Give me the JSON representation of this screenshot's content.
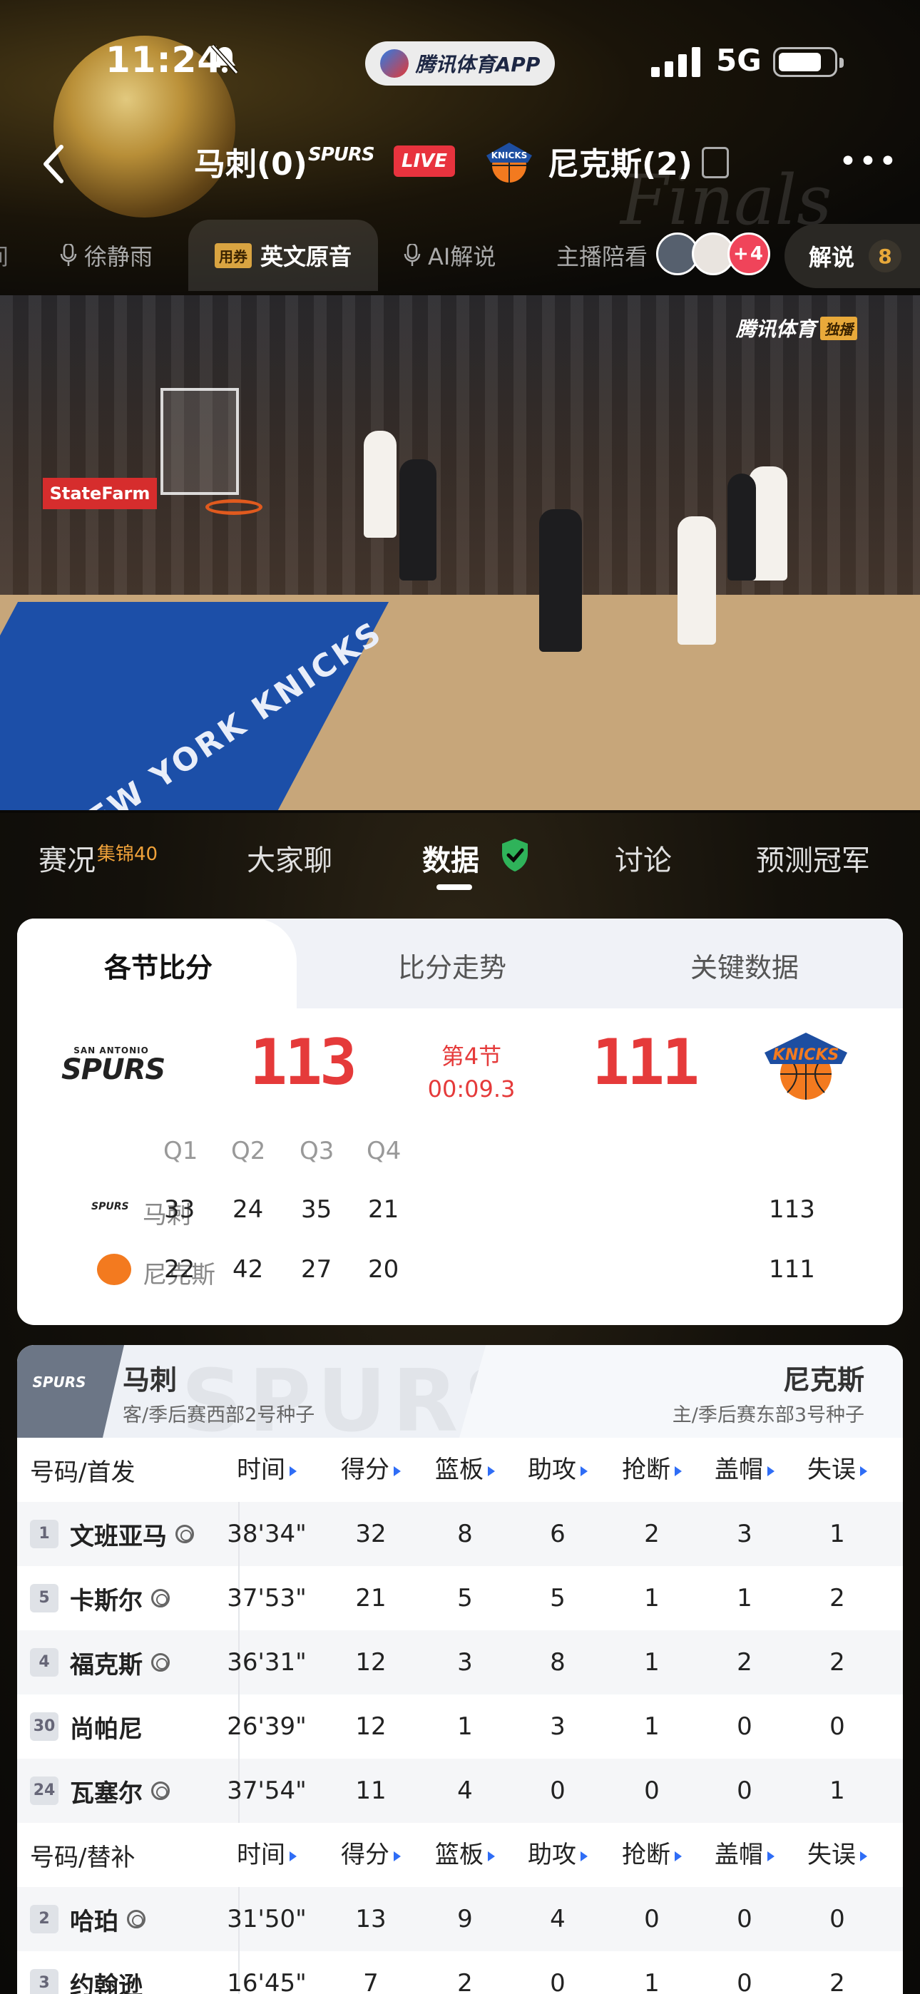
{
  "status_bar": {
    "time": "11:24",
    "app_pill": "腾讯体育APP",
    "network": "5G",
    "battery_level": 0.8
  },
  "header": {
    "team_a": "马刺(0)",
    "team_a_logo_text": "SPURS",
    "live": "LIVE",
    "team_b": "尼克斯(2)"
  },
  "commentary": {
    "tabs": [
      "徐静雨",
      "英文原音",
      "AI解说",
      "主播陪看"
    ],
    "coupon": "用券",
    "active": "英文原音",
    "more_avatars": "+4",
    "jieshuo_label": "解说",
    "jieshuo_count": "8"
  },
  "video": {
    "watermark": "腾讯体育",
    "exclusive": "独播",
    "sponsor": "StateFarm",
    "court_text": "NEW YORK KNICKS"
  },
  "main_tabs": [
    {
      "label": "赛况",
      "badge": "集锦40"
    },
    {
      "label": "大家聊",
      "badge": ""
    },
    {
      "label": "数据",
      "badge": ""
    },
    {
      "label": "讨论",
      "badge": ""
    },
    {
      "label": "预测冠军",
      "badge": ""
    }
  ],
  "score_card": {
    "tabs": [
      "各节比分",
      "比分走势",
      "关键数据"
    ],
    "spurs_logo_top": "SAN ANTONIO",
    "spurs_logo": "SPURS",
    "knicks_logo": "KNICKS",
    "home_score": "113",
    "away_score": "111",
    "period": "第4节",
    "clock": "00:09.3",
    "quarters": [
      "Q1",
      "Q2",
      "Q3",
      "Q4"
    ],
    "rows": [
      {
        "team": "马刺",
        "q": [
          "33",
          "24",
          "35",
          "21"
        ],
        "total": "113"
      },
      {
        "team": "尼克斯",
        "q": [
          "22",
          "42",
          "27",
          "20"
        ],
        "total": "111"
      }
    ]
  },
  "stats": {
    "left_team": "马刺",
    "left_sub": "客/季后赛西部2号种子",
    "right_team": "尼克斯",
    "right_sub": "主/季后赛东部3号种子",
    "ghost": "SPURS",
    "starters_header": [
      "号码/首发",
      "时间",
      "得分",
      "篮板",
      "助攻",
      "抢断",
      "盖帽",
      "失误"
    ],
    "bench_header": [
      "号码/替补",
      "时间",
      "得分",
      "篮板",
      "助攻",
      "抢断",
      "盖帽",
      "失误"
    ],
    "starters": [
      {
        "num": "1",
        "name": "文班亚马",
        "star": true,
        "vals": [
          "38'34\"",
          "32",
          "8",
          "6",
          "2",
          "3",
          "1"
        ]
      },
      {
        "num": "5",
        "name": "卡斯尔",
        "star": true,
        "vals": [
          "37'53\"",
          "21",
          "5",
          "5",
          "1",
          "1",
          "2"
        ]
      },
      {
        "num": "4",
        "name": "福克斯",
        "star": true,
        "vals": [
          "36'31\"",
          "12",
          "3",
          "8",
          "1",
          "2",
          "2"
        ]
      },
      {
        "num": "30",
        "name": "尚帕尼",
        "star": false,
        "vals": [
          "26'39\"",
          "12",
          "1",
          "3",
          "1",
          "0",
          "0"
        ]
      },
      {
        "num": "24",
        "name": "瓦塞尔",
        "star": true,
        "vals": [
          "37'54\"",
          "11",
          "4",
          "0",
          "0",
          "0",
          "1"
        ]
      }
    ],
    "bench": [
      {
        "num": "2",
        "name": "哈珀",
        "star": true,
        "vals": [
          "31'50\"",
          "13",
          "9",
          "4",
          "0",
          "0",
          "0"
        ]
      },
      {
        "num": "3",
        "name": "约翰逊",
        "star": false,
        "vals": [
          "16'45\"",
          "7",
          "2",
          "0",
          "1",
          "0",
          "2"
        ]
      }
    ]
  },
  "colors": {
    "live_red": "#e8333e",
    "score_red": "#e53a3a",
    "badge_orange": "#f0a23a",
    "shield_green": "#2fb35a",
    "sort_blue": "#2f6df6"
  }
}
